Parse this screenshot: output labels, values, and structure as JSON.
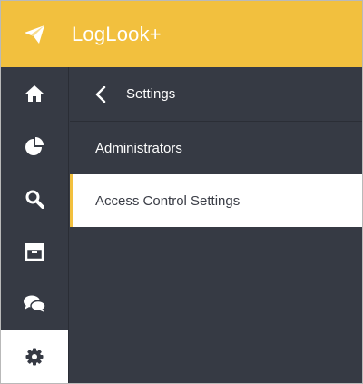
{
  "app": {
    "title": "LogLook+",
    "accent_color": "#f2c03e",
    "sidebar_bg": "#363a44"
  },
  "rail": {
    "items": [
      {
        "icon": "home-icon",
        "active": false
      },
      {
        "icon": "pie-chart-icon",
        "active": false
      },
      {
        "icon": "search-icon",
        "active": false
      },
      {
        "icon": "archive-icon",
        "active": false
      },
      {
        "icon": "chat-icon",
        "active": false
      },
      {
        "icon": "gear-icon",
        "active": true
      }
    ]
  },
  "panel": {
    "title": "Settings",
    "items": [
      {
        "label": "Administrators",
        "active": false
      },
      {
        "label": "Access Control Settings",
        "active": true
      }
    ]
  }
}
